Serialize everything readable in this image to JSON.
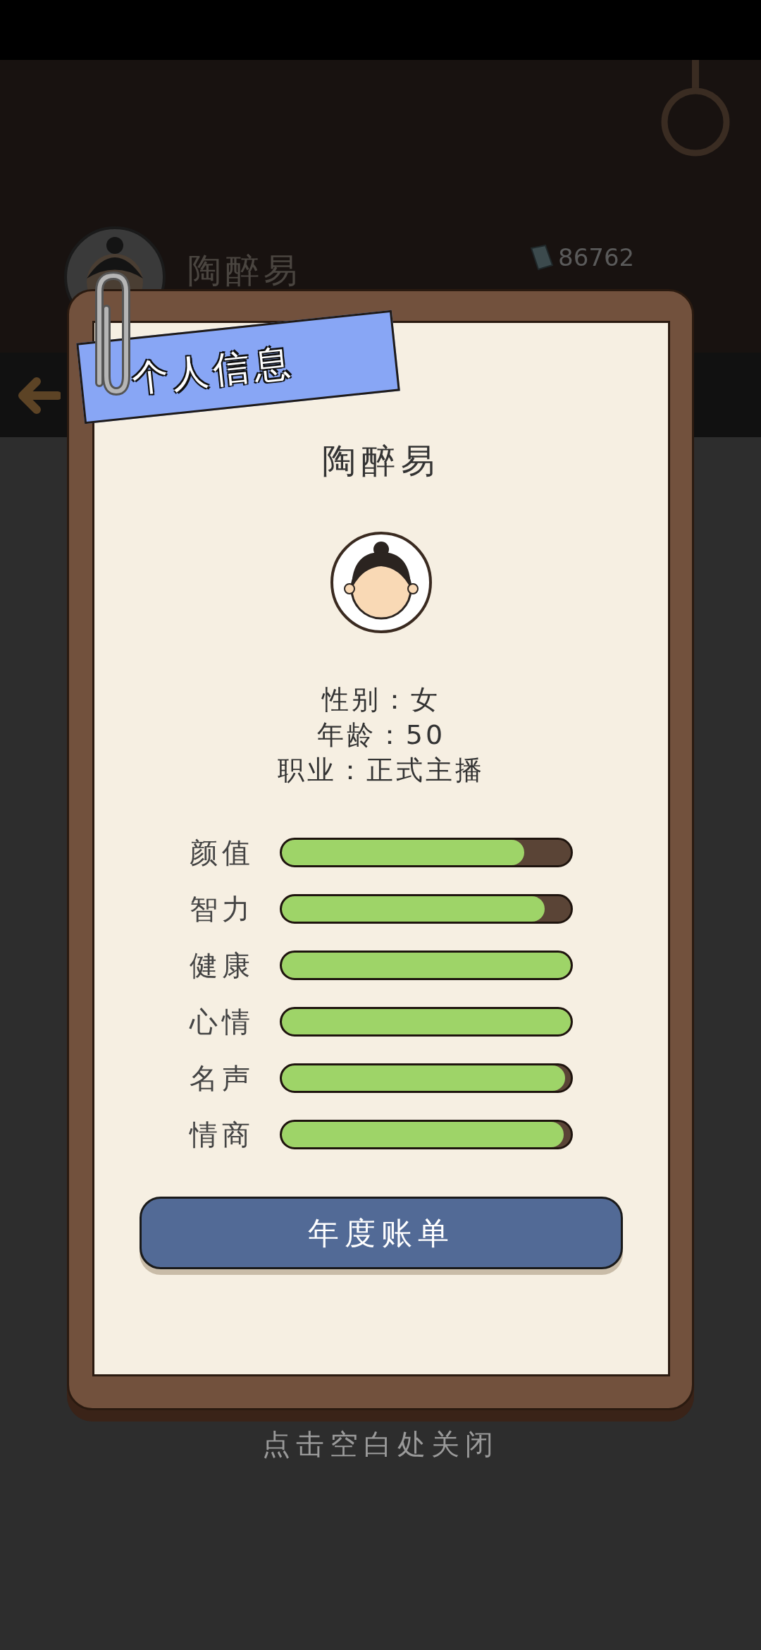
{
  "background": {
    "player_name": "陶醉易",
    "money": "86762"
  },
  "dialog": {
    "title": "个人信息",
    "name": "陶醉易",
    "info": [
      "性别：女",
      "年龄：50",
      "职业：正式主播"
    ],
    "stats": [
      {
        "label": "颜值",
        "level": 0.84
      },
      {
        "label": "智力",
        "level": 0.91
      },
      {
        "label": "健康",
        "level": 1
      },
      {
        "label": "心情",
        "level": 1
      },
      {
        "label": "名声",
        "level": 0.98
      },
      {
        "label": "情商",
        "level": 0.975
      }
    ],
    "button": "年度账单"
  },
  "close_hint": "点击空白处关闭"
}
